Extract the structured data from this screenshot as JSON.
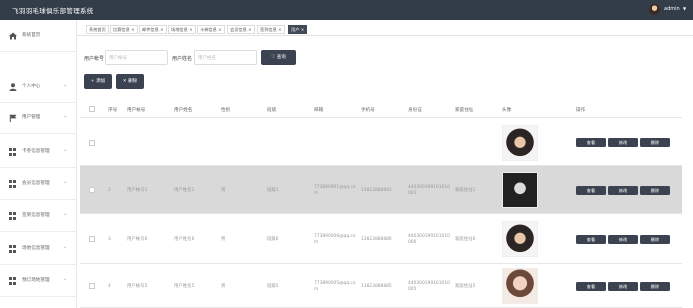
{
  "app": {
    "title": "飞羽羽毛球俱乐部管理系统",
    "user_name": "admin"
  },
  "sidebar": {
    "items": [
      {
        "label": "系统首页",
        "icon": "home-icon",
        "has_chevron": false
      },
      {
        "label": "个人中心",
        "icon": "person-icon",
        "has_chevron": true
      },
      {
        "label": "用户管理",
        "icon": "flag-icon",
        "has_chevron": true
      },
      {
        "label": "卡券信息管理",
        "icon": "grid-icon",
        "has_chevron": true
      },
      {
        "label": "会员信息管理",
        "icon": "grid-icon",
        "has_chevron": true
      },
      {
        "label": "签到信息管理",
        "icon": "grid-icon",
        "has_chevron": true
      },
      {
        "label": "场地信息管理",
        "icon": "grid-icon",
        "has_chevron": true
      },
      {
        "label": "预订场地管理",
        "icon": "grid-icon",
        "has_chevron": true
      }
    ]
  },
  "tabs": [
    {
      "label": "系统首页",
      "active": false
    },
    {
      "label": "比赛信息 ×",
      "active": false
    },
    {
      "label": "邮件信息 ×",
      "active": false
    },
    {
      "label": "场地信息 ×",
      "active": false
    },
    {
      "label": "卡券信息 ×",
      "active": false
    },
    {
      "label": "会员信息 ×",
      "active": false
    },
    {
      "label": "签到信息 ×",
      "active": false
    },
    {
      "label": "用户 ×",
      "active": true
    }
  ],
  "search": {
    "account_label": "用户帐号",
    "account_placeholder": "用户帐号",
    "name_label": "用户姓名",
    "name_placeholder": "用户姓名",
    "query_button": "查询"
  },
  "toolbar": {
    "add_label": "添加",
    "delete_label": "删除"
  },
  "table": {
    "headers": [
      "序号",
      "用户帐号",
      "用户姓名",
      "性别",
      "班级",
      "邮箱",
      "手机号",
      "身份证",
      "家庭住址",
      "头像",
      "操作"
    ],
    "action_labels": [
      "查看",
      "修改",
      "删除"
    ],
    "rows": [
      {
        "no": "",
        "account": "",
        "name": "",
        "gender": "",
        "class": "",
        "email": "",
        "phone": "",
        "id_card": "",
        "address": "",
        "selected": false,
        "photo_style": "dark-hair"
      },
      {
        "no": "2",
        "account": "用户帐号1",
        "name": "用户姓名1",
        "gender": "男",
        "class": "班级1",
        "email": "773890001@qq.com",
        "phone": "13823888881",
        "id_card": "440300199101010001",
        "address": "家庭住址1",
        "selected": true,
        "photo_style": "anime"
      },
      {
        "no": "3",
        "account": "用户帐号6",
        "name": "用户姓名6",
        "gender": "男",
        "class": "班级6",
        "email": "773890006@qq.com",
        "phone": "13823888886",
        "id_card": "440300199101010006",
        "address": "家庭住址6",
        "selected": false,
        "photo_style": "dark-hair"
      },
      {
        "no": "4",
        "account": "用户帐号5",
        "name": "用户姓名5",
        "gender": "男",
        "class": "班级5",
        "email": "773890005@qq.com",
        "phone": "13823888885",
        "id_card": "440300199101010005",
        "address": "家庭住址5",
        "selected": false,
        "photo_style": "portrait"
      }
    ]
  },
  "colors": {
    "header_bg": "#333d4a",
    "button_bg": "#3b4350",
    "selected_row": "#d9d9d9"
  }
}
